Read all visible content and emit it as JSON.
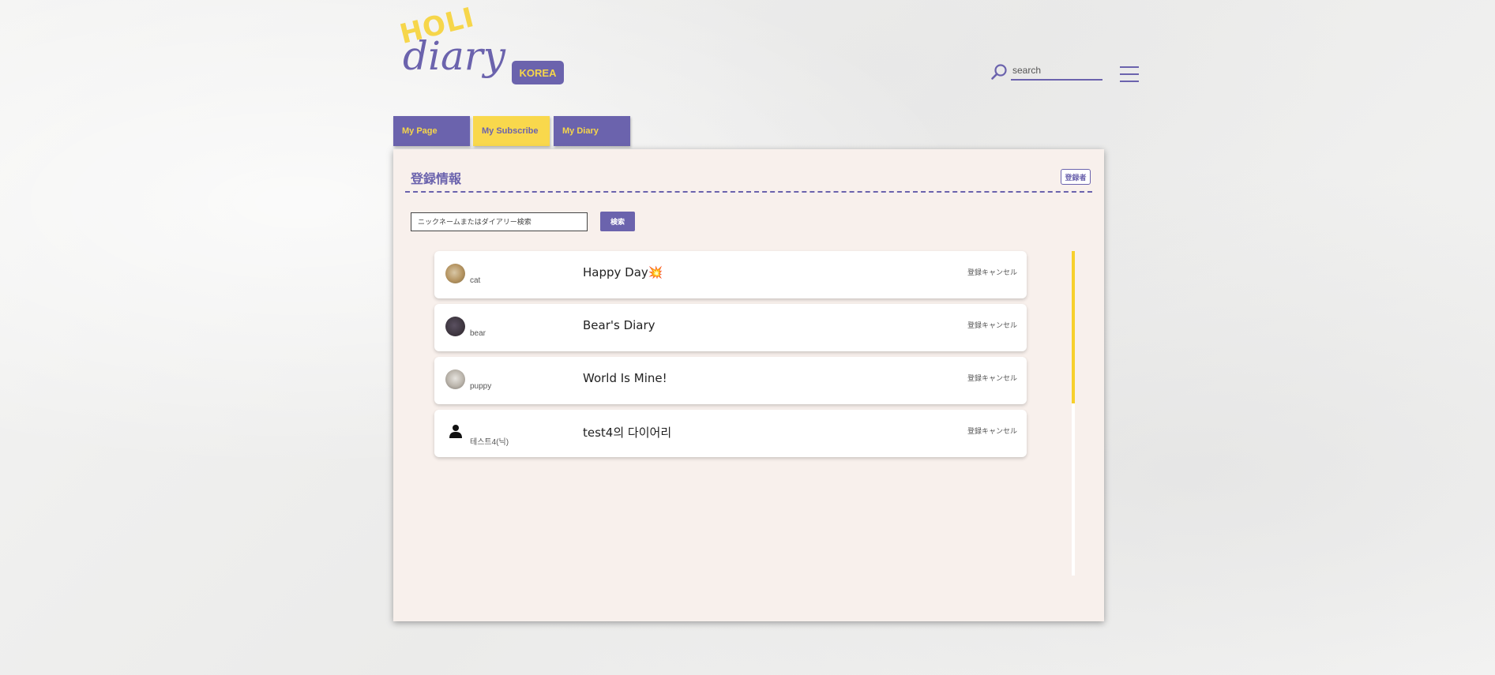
{
  "header": {
    "logo_top": "HOLI",
    "logo_bottom": "diary",
    "region_badge": "KOREA",
    "search_placeholder": "search"
  },
  "tabs": [
    {
      "label": "My Page"
    },
    {
      "label": "My Subscribe"
    },
    {
      "label": "My Diary"
    }
  ],
  "panel": {
    "title": "登録情報",
    "subscriber_button": "登録者",
    "search_placeholder": "ニックネームまたはダイアリー検索",
    "search_button": "検索"
  },
  "subscriptions": [
    {
      "nickname": "cat",
      "diary": "Happy Day💥",
      "action": "登録キャンセル",
      "avatar": "cat-photo"
    },
    {
      "nickname": "bear",
      "diary": "Bear's Diary",
      "action": "登録キャンセル",
      "avatar": "bear-photo"
    },
    {
      "nickname": "puppy",
      "diary": "World Is Mine!",
      "action": "登録キャンセル",
      "avatar": "puppy-photo"
    },
    {
      "nickname": "테스트4(닉)",
      "diary": "test4의 다이어리",
      "action": "登録キャンセル",
      "avatar": "user-icon"
    }
  ],
  "colors": {
    "brand_purple": "#6b63ad",
    "brand_yellow": "#f6d64a",
    "panel_bg": "#f8f0ec"
  }
}
